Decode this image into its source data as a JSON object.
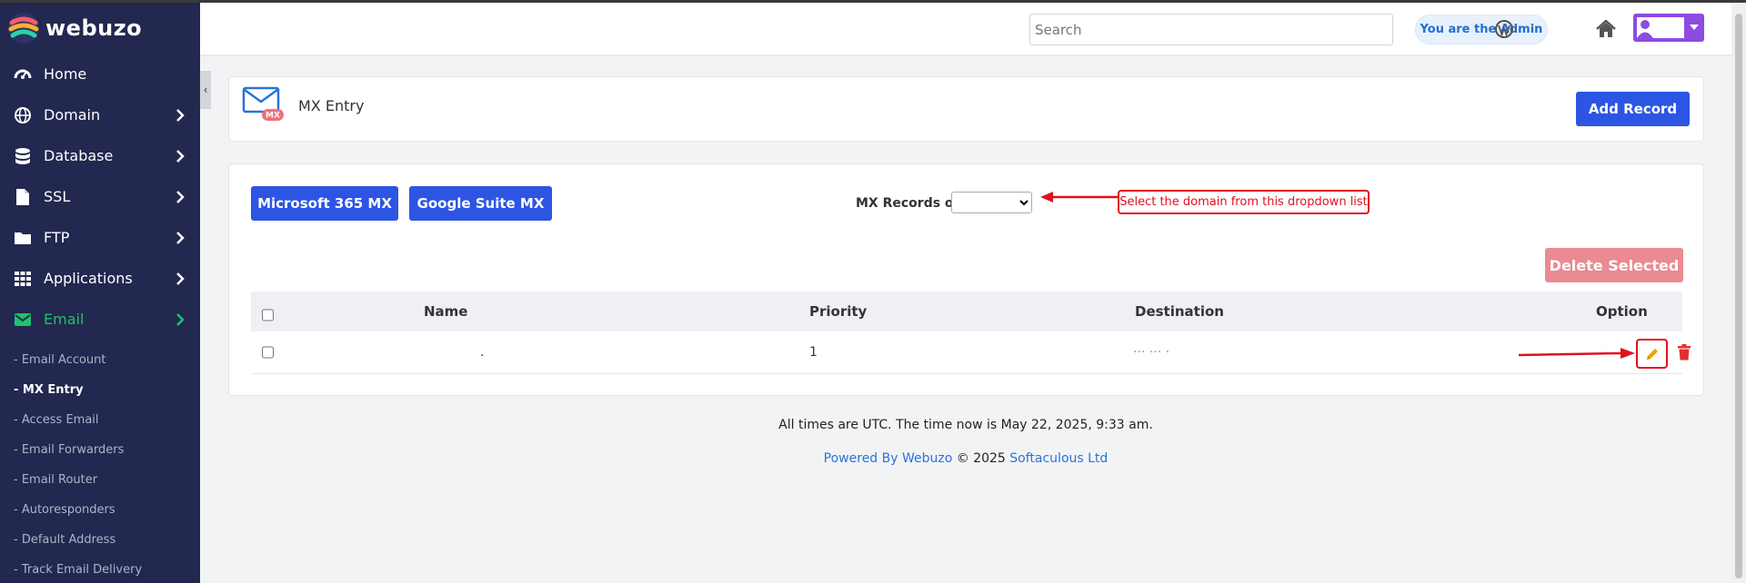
{
  "app": {
    "brand": "webuzo"
  },
  "colors": {
    "sidebar_bg": "#22284f",
    "primary": "#2d55e3",
    "accent_green": "#21c16b",
    "danger_light": "#ea8a92",
    "annotation_red": "#e0101f",
    "user_btn": "#8c4be1"
  },
  "header": {
    "search_placeholder": "Search",
    "admin_badge": "You are the Admin",
    "icons": [
      "wordpress-icon",
      "home-icon",
      "user-avatar-icon"
    ]
  },
  "sidebar": {
    "items": [
      {
        "label": "Home",
        "icon": "dashboard-icon",
        "has_chevron": false
      },
      {
        "label": "Domain",
        "icon": "globe-icon",
        "has_chevron": true
      },
      {
        "label": "Database",
        "icon": "database-icon",
        "has_chevron": true
      },
      {
        "label": "SSL",
        "icon": "file-icon",
        "has_chevron": true
      },
      {
        "label": "FTP",
        "icon": "folder-icon",
        "has_chevron": true
      },
      {
        "label": "Applications",
        "icon": "grid-icon",
        "has_chevron": true
      },
      {
        "label": "Email",
        "icon": "envelope-icon",
        "has_chevron": true,
        "active": true
      }
    ],
    "submenu": [
      {
        "label": "- Email Account"
      },
      {
        "label": "- MX Entry",
        "active": true
      },
      {
        "label": "- Access Email"
      },
      {
        "label": "- Email Forwarders"
      },
      {
        "label": "- Email Router"
      },
      {
        "label": "- Autoresponders"
      },
      {
        "label": "- Default Address"
      },
      {
        "label": "- Track Email Delivery"
      }
    ]
  },
  "page": {
    "title": "MX Entry",
    "title_icon_badge": "MX",
    "add_record": "Add Record"
  },
  "main": {
    "microsoft_btn": "Microsoft 365 MX",
    "google_btn": "Google Suite MX",
    "mx_records_label": "MX Records of",
    "domain_select_value": "",
    "annotation": "Select the domain from this dropdown list",
    "delete_selected": "Delete Selected",
    "table": {
      "headers": {
        "name": "Name",
        "priority": "Priority",
        "destination": "Destination",
        "option": "Option"
      },
      "rows": [
        {
          "name": ".",
          "priority": "1",
          "destination": "··· ··· ·"
        }
      ]
    }
  },
  "footer": {
    "time_text": "All times are UTC. The time now is May 22, 2025, 9:33 am.",
    "powered_link": "Powered By Webuzo",
    "copyright": " © 2025 ",
    "company_link": "Softaculous Ltd"
  }
}
